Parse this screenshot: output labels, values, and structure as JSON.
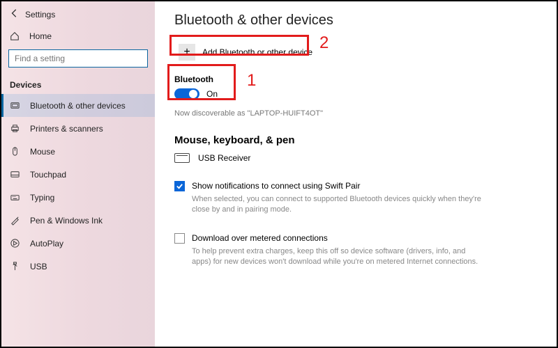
{
  "header": {
    "title": "Settings",
    "home": "Home"
  },
  "search": {
    "placeholder": "Find a setting"
  },
  "section": "Devices",
  "nav": {
    "items": [
      {
        "label": "Bluetooth & other devices"
      },
      {
        "label": "Printers & scanners"
      },
      {
        "label": "Mouse"
      },
      {
        "label": "Touchpad"
      },
      {
        "label": "Typing"
      },
      {
        "label": "Pen & Windows Ink"
      },
      {
        "label": "AutoPlay"
      },
      {
        "label": "USB"
      }
    ]
  },
  "page": {
    "title": "Bluetooth & other devices",
    "add_label": "Add Bluetooth or other device",
    "bt_label": "Bluetooth",
    "bt_state": "On",
    "discover": "Now discoverable as \"LAPTOP-HUIFT4OT\"",
    "subhead": "Mouse, keyboard, & pen",
    "device1": "USB Receiver",
    "swift_pair_label": "Show notifications to connect using Swift Pair",
    "swift_pair_help": "When selected, you can connect to supported Bluetooth devices quickly when they're close by and in pairing mode.",
    "metered_label": "Download over metered connections",
    "metered_help": "To help prevent extra charges, keep this off so device software (drivers, info, and apps) for new devices won't download while you're on metered Internet connections."
  },
  "annotations": {
    "one": "1",
    "two": "2"
  }
}
